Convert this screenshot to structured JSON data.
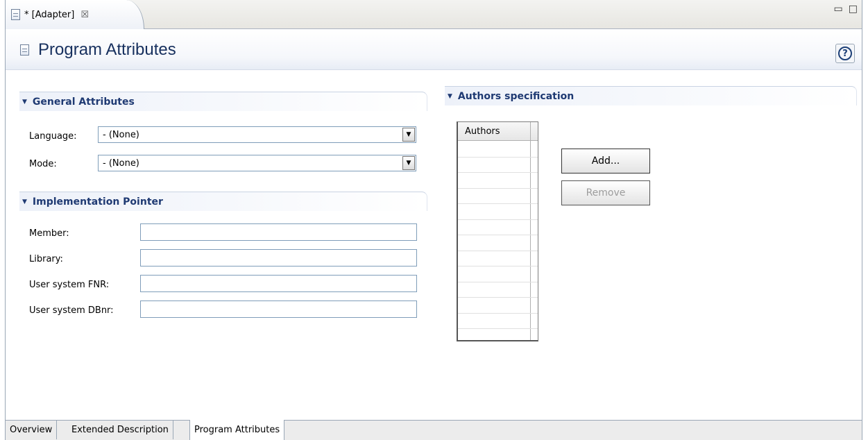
{
  "editor_tab": {
    "title": "* [Adapter]",
    "close_icon": "close-icon"
  },
  "window_controls": {
    "minimize": "▭",
    "maximize": "□"
  },
  "header": {
    "title": "Program Attributes",
    "help": "?"
  },
  "general": {
    "title": "General Attributes",
    "language_label": "Language:",
    "language_value": "- (None)",
    "mode_label": "Mode:",
    "mode_value": "- (None)"
  },
  "implementation": {
    "title": "Implementation Pointer",
    "member_label": "Member:",
    "member_value": "",
    "library_label": "Library:",
    "library_value": "",
    "fnr_label": "User system FNR:",
    "fnr_value": "",
    "dbnr_label": "User system DBnr:",
    "dbnr_value": ""
  },
  "authors": {
    "title": "Authors specification",
    "column_header": "Authors",
    "rows": [],
    "add_label": "Add...",
    "remove_label": "Remove"
  },
  "bottom_tabs": {
    "overview": "Overview",
    "extended": "Extended Description",
    "program_attributes": "Program Attributes",
    "active": "Program Attributes"
  }
}
